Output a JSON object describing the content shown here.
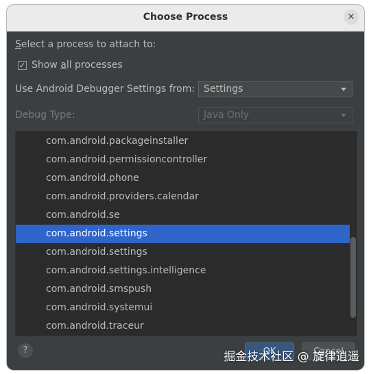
{
  "dialog": {
    "title": "Choose Process",
    "close_icon": "×"
  },
  "form": {
    "prompt_first": "S",
    "prompt_rest": "elect a process to attach to:",
    "show_all_prefix": "Show ",
    "show_all_u": "a",
    "show_all_suffix": "ll processes",
    "show_all_checked": true,
    "checkmark": "✓",
    "debugger_label": "Use Android Debugger Settings from:",
    "debugger_value": "Settings",
    "debug_type_label": "Debug Type:",
    "debug_type_value": "Java Only"
  },
  "processes": [
    "com.android.packageinstaller",
    "com.android.permissioncontroller",
    "com.android.phone",
    "com.android.providers.calendar",
    "com.android.se",
    "com.android.settings",
    "com.android.settings",
    "com.android.settings.intelligence",
    "com.android.smspush",
    "com.android.systemui",
    "com.android.traceur"
  ],
  "selected_index": 5,
  "footer": {
    "help_label": "?",
    "ok_label": "OK",
    "cancel_label": "Cancel"
  },
  "watermark": "掘金技术社区 @ 旋律逍遥",
  "colors": {
    "selection": "#2f65ca",
    "dialog_bg": "#3c3f41",
    "list_bg": "#2b2b2b"
  }
}
